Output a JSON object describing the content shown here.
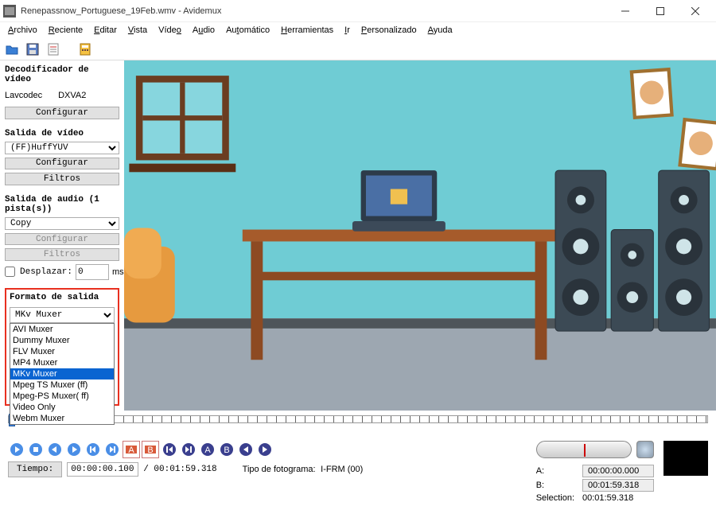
{
  "window": {
    "title": "Renepassnow_Portuguese_19Feb.wmv - Avidemux"
  },
  "menu": {
    "archivo": "Archivo",
    "reciente": "Reciente",
    "editar": "Editar",
    "vista": "Vista",
    "video": "Vídeo",
    "audio": "Audio",
    "automatico": "Automático",
    "herramientas": "Herramientas",
    "ir": "Ir",
    "personalizado": "Personalizado",
    "ayuda": "Ayuda"
  },
  "decoder": {
    "title": "Decodificador de vídeo",
    "codec": "Lavcodec",
    "hw": "DXVA2",
    "configure": "Configurar"
  },
  "vout": {
    "title": "Salida de vídeo",
    "selected": "(FF)HuffYUV",
    "configure": "Configurar",
    "filters": "Filtros"
  },
  "aout": {
    "title": "Salida de audio (1 pista(s))",
    "selected": "Copy",
    "configure": "Configurar",
    "filters": "Filtros",
    "shift_label": "Desplazar:",
    "shift_value": "0",
    "shift_unit": "ms"
  },
  "format": {
    "title": "Formato de salida",
    "selected": "MKv Muxer",
    "options": [
      "AVI Muxer",
      "Dummy Muxer",
      "FLV Muxer",
      "MP4 Muxer",
      "MKv Muxer",
      "Mpeg TS Muxer (ff)",
      "Mpeg-PS Muxer( ff)",
      "Video Only",
      "Webm Muxer"
    ],
    "highlight_index": 4
  },
  "status": {
    "time_label": "Tiempo:",
    "time_value": "00:00:00.100",
    "duration": "/ 00:01:59.318",
    "frame_type_label": "Tipo de fotograma:",
    "frame_type": "I-FRM (00)",
    "a_label": "A:",
    "a_value": "00:00:00.000",
    "b_label": "B:",
    "b_value": "00:01:59.318",
    "sel_label": "Selection:",
    "sel_value": "00:01:59.318"
  }
}
